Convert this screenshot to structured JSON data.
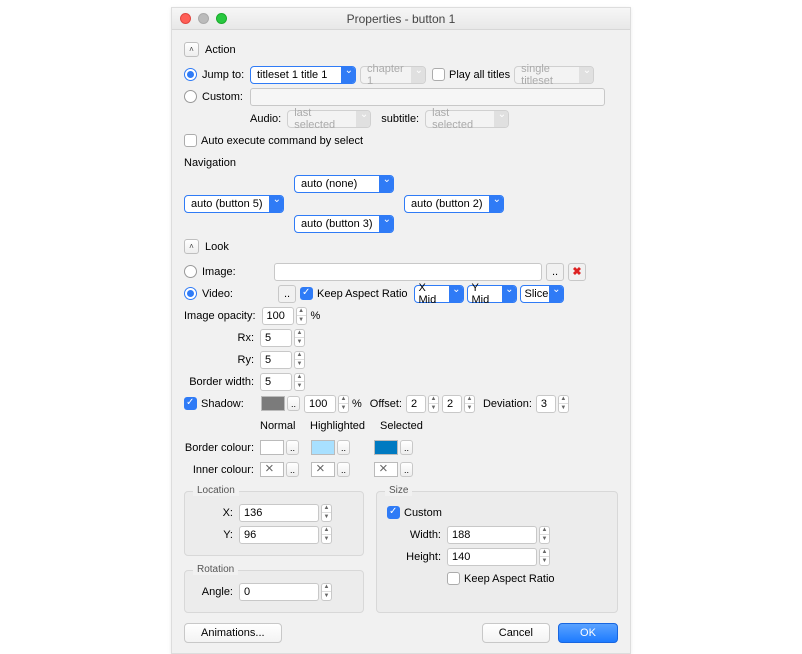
{
  "window": {
    "title": "Properties - button 1"
  },
  "action": {
    "header": "Action",
    "jumpto_label": "Jump to:",
    "jumpto_target": "titleset 1 title 1",
    "chapter": "chapter 1",
    "play_all": "Play all titles",
    "mode": "single titleset",
    "custom_label": "Custom:",
    "audio_label": "Audio:",
    "audio_value": "last selected",
    "subtitle_label": "subtitle:",
    "subtitle_value": "last selected",
    "auto_exec": "Auto execute command by select",
    "navigation_label": "Navigation",
    "nav_up": "auto (none)",
    "nav_left": "auto (button 5)",
    "nav_right": "auto (button 2)",
    "nav_down": "auto (button 3)"
  },
  "look": {
    "header": "Look",
    "image_label": "Image:",
    "video_label": "Video:",
    "keep_aspect": "Keep Aspect Ratio",
    "xpos": "X Mid",
    "ypos": "Y Mid",
    "slice": "Slice",
    "opacity_label": "Image opacity:",
    "opacity_value": "100",
    "opacity_unit": "%",
    "rx_label": "Rx:",
    "rx_value": "5",
    "ry_label": "Ry:",
    "ry_value": "5",
    "border_label": "Border width:",
    "border_value": "5",
    "shadow_label": "Shadow:",
    "shadow_opacity": "100",
    "shadow_unit": "%",
    "offset_label": "Offset:",
    "offset_x": "2",
    "offset_y": "2",
    "deviation_label": "Deviation:",
    "deviation": "3",
    "col_normal": "Normal",
    "col_high": "Highlighted",
    "col_sel": "Selected",
    "border_colour": "Border colour:",
    "inner_colour": "Inner colour:"
  },
  "location": {
    "title": "Location",
    "x_label": "X:",
    "x": "136",
    "y_label": "Y:",
    "y": "96"
  },
  "rotation": {
    "title": "Rotation",
    "angle_label": "Angle:",
    "angle": "0"
  },
  "size": {
    "title": "Size",
    "custom": "Custom",
    "w_label": "Width:",
    "w": "188",
    "h_label": "Height:",
    "h": "140",
    "keep": "Keep Aspect Ratio"
  },
  "buttons": {
    "animations": "Animations...",
    "cancel": "Cancel",
    "ok": "OK"
  }
}
